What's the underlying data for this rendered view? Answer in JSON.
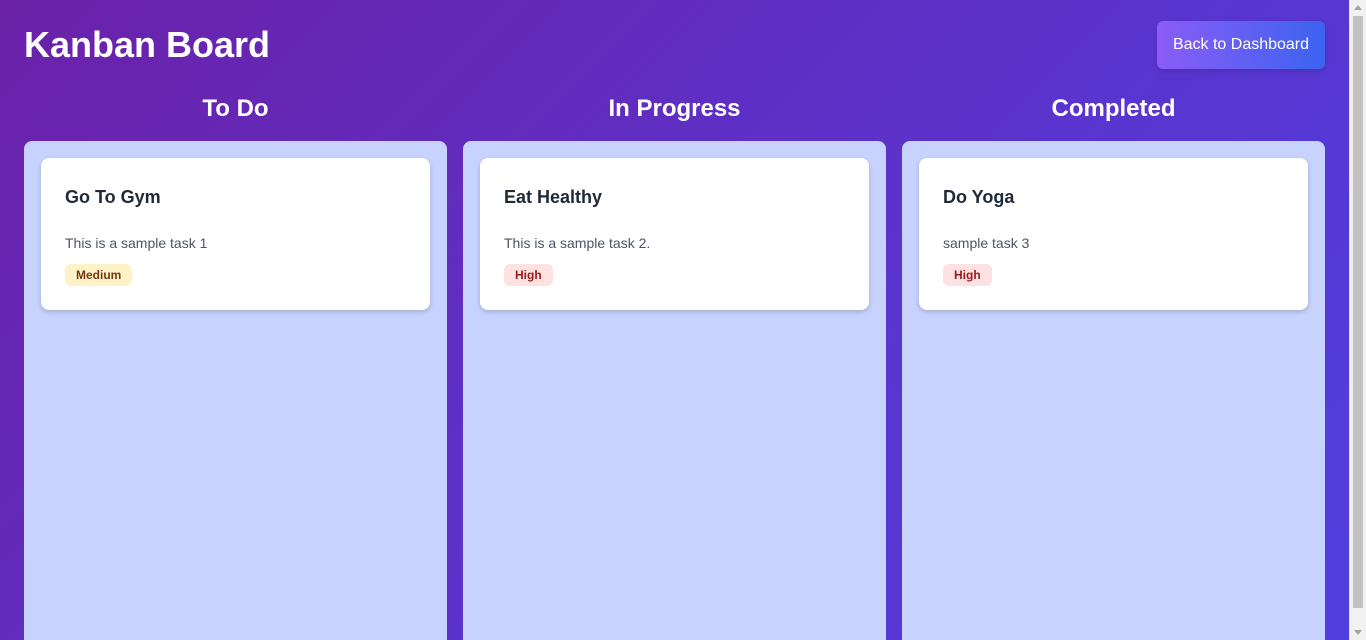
{
  "header": {
    "title": "Kanban Board",
    "back_button_label": "Back to Dashboard"
  },
  "columns": [
    {
      "title": "To Do",
      "tasks": [
        {
          "title": "Go To Gym",
          "description": "This is a sample task 1",
          "priority": "Medium"
        }
      ]
    },
    {
      "title": "In Progress",
      "tasks": [
        {
          "title": "Eat Healthy",
          "description": "This is a sample task 2.",
          "priority": "High"
        }
      ]
    },
    {
      "title": "Completed",
      "tasks": [
        {
          "title": "Do Yoga",
          "description": "sample task 3",
          "priority": "High"
        }
      ]
    }
  ],
  "colors": {
    "column_background": "#c7d2fe",
    "medium_badge_bg": "#fef3c7",
    "high_badge_bg": "#fee2e2",
    "button_gradient_start": "#8b5cf6",
    "button_gradient_end": "#3b63f0"
  }
}
